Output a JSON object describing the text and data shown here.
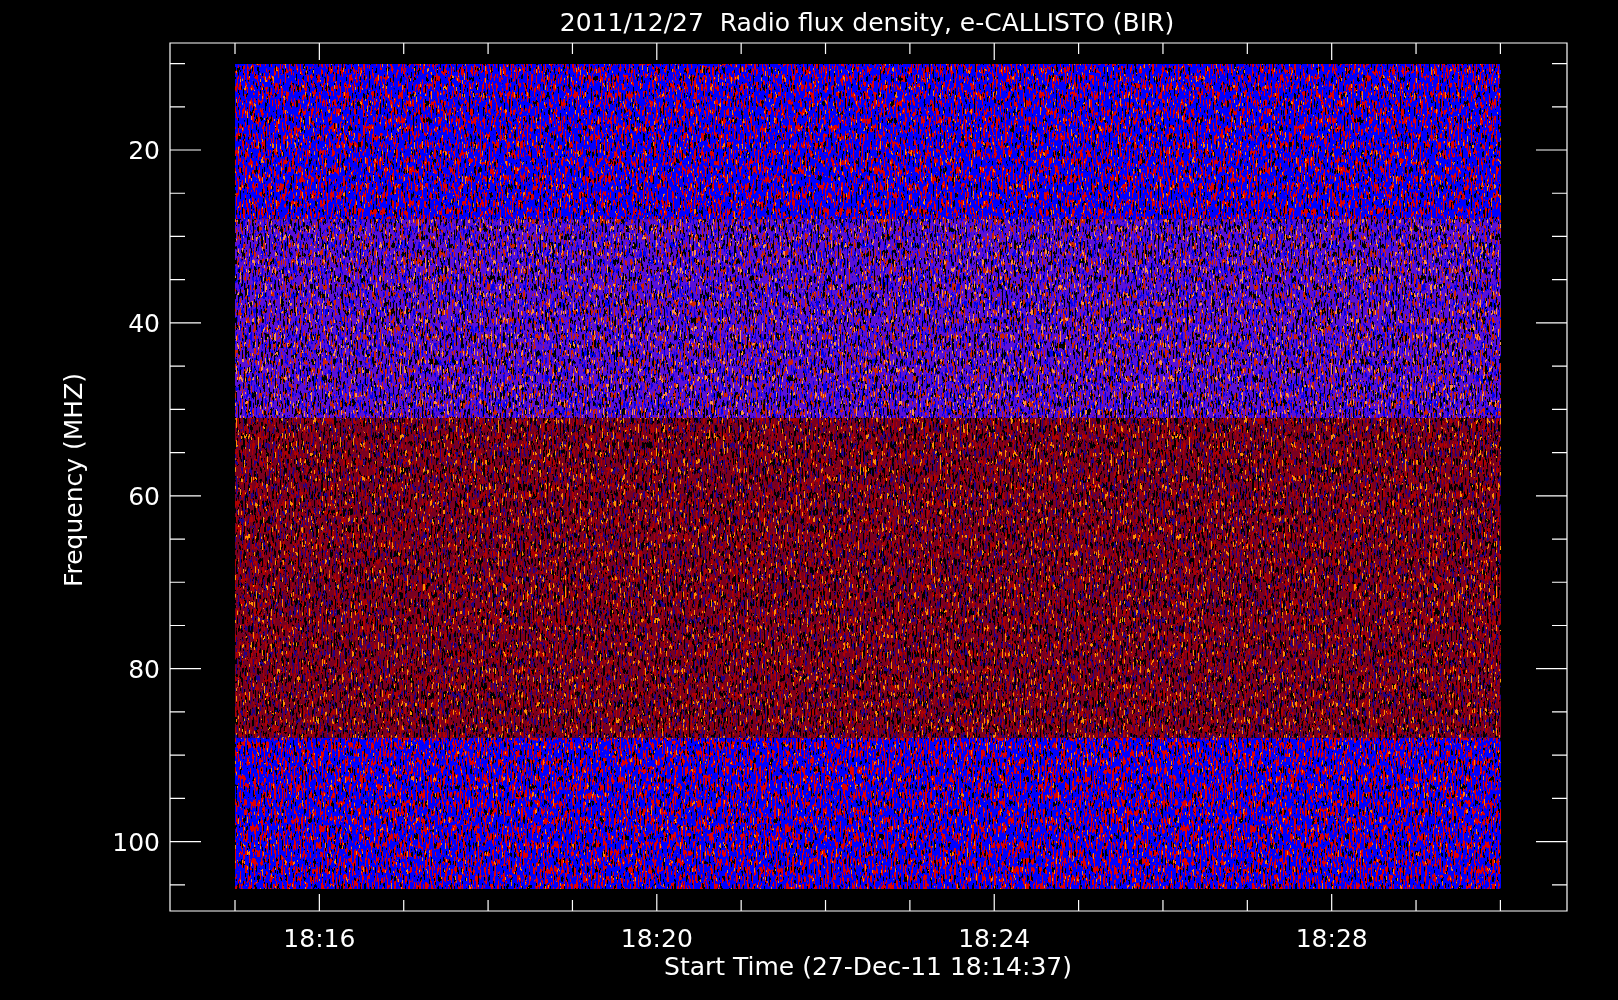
{
  "title": "2011/12/27  Radio flux density, e-CALLISTO (BIR)",
  "y_axis": {
    "label": "Frequency (MHZ)",
    "ticks": [
      "20",
      "40",
      "60",
      "80",
      "100"
    ]
  },
  "x_axis": {
    "label": "Start Time (27-Dec-11 18:14:37)",
    "ticks": [
      "18:16",
      "18:20",
      "18:24",
      "18:28"
    ]
  }
}
